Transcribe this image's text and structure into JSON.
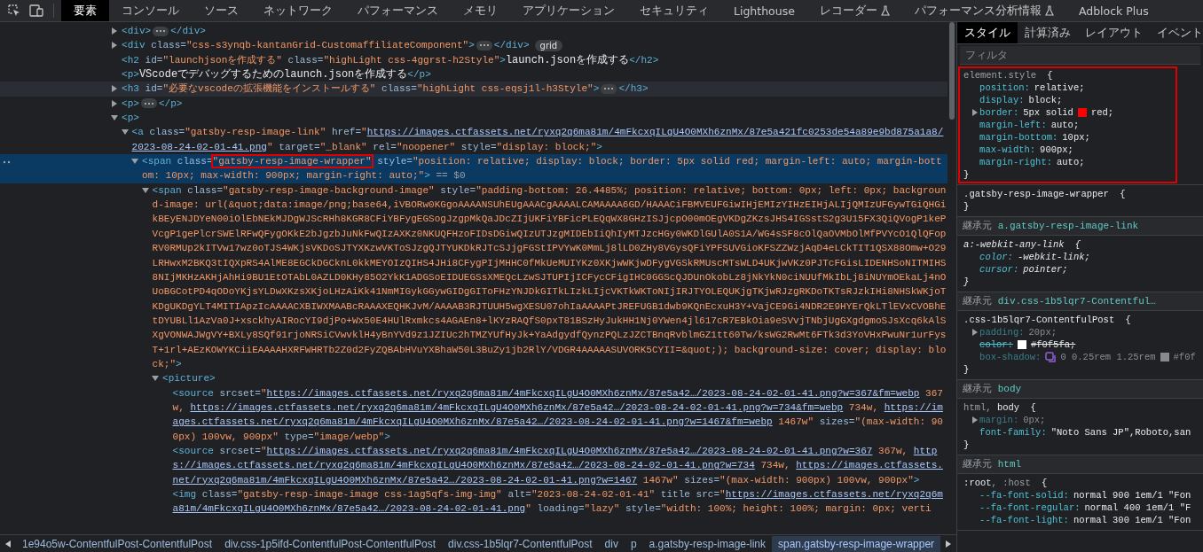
{
  "tabs": [
    {
      "label": "要素",
      "selected": true,
      "experimental": false
    },
    {
      "label": "コンソール",
      "selected": false,
      "experimental": false
    },
    {
      "label": "ソース",
      "selected": false,
      "experimental": false
    },
    {
      "label": "ネットワーク",
      "selected": false,
      "experimental": false
    },
    {
      "label": "パフォーマンス",
      "selected": false,
      "experimental": false
    },
    {
      "label": "メモリ",
      "selected": false,
      "experimental": false
    },
    {
      "label": "アプリケーション",
      "selected": false,
      "experimental": false
    },
    {
      "label": "セキュリティ",
      "selected": false,
      "experimental": false
    },
    {
      "label": "Lighthouse",
      "selected": false,
      "experimental": false
    },
    {
      "label": "レコーダー",
      "selected": false,
      "experimental": true
    },
    {
      "label": "パフォーマンス分析情報",
      "selected": false,
      "experimental": true
    },
    {
      "label": "Adblock Plus",
      "selected": false,
      "experimental": false
    }
  ],
  "elements": [
    {
      "selected": false,
      "hovered": false,
      "expanded": false,
      "parts": [
        {
          "kind": "tag",
          "text": "<div>"
        },
        {
          "kind": "ellipsis"
        },
        {
          "kind": "tag",
          "text": "</div>"
        }
      ]
    },
    {
      "selected": false,
      "hovered": false,
      "expanded": false,
      "parts": [
        {
          "kind": "tag",
          "text": "<div"
        },
        {
          "kind": "attr",
          "text": " class="
        },
        {
          "kind": "value",
          "text": "\"css-s3ynqb-kantanGrid-CustomaffiliateComponent\""
        },
        {
          "kind": "tag",
          "text": ">"
        },
        {
          "kind": "ellipsis"
        },
        {
          "kind": "tag",
          "text": "</div>"
        },
        {
          "kind": "badge",
          "text": "grid"
        }
      ]
    },
    {
      "selected": false,
      "hovered": false,
      "parts": [
        {
          "kind": "tag",
          "text": "<h2"
        },
        {
          "kind": "attr",
          "text": " id="
        },
        {
          "kind": "value",
          "text": "\"launchjsonを作成する\""
        },
        {
          "kind": "attr",
          "text": " class="
        },
        {
          "kind": "value",
          "text": "\"highLight css-4ggrst-h2Style\""
        },
        {
          "kind": "tag",
          "text": ">"
        },
        {
          "kind": "text",
          "text": "launch.jsonを作成する"
        },
        {
          "kind": "tag",
          "text": "</h2>"
        }
      ]
    },
    {
      "selected": false,
      "hovered": false,
      "parts": [
        {
          "kind": "tag",
          "text": "<p>"
        },
        {
          "kind": "text",
          "text": "VScodeでデバッグするためのlaunch.jsonを作成する"
        },
        {
          "kind": "tag",
          "text": "</p>"
        }
      ]
    },
    {
      "selected": false,
      "hovered": true,
      "expanded": false,
      "parts": [
        {
          "kind": "tag",
          "text": "<h3"
        },
        {
          "kind": "attr",
          "text": " id="
        },
        {
          "kind": "value",
          "text": "\"必要なvscodeの拡張機能をインストールする\""
        },
        {
          "kind": "attr",
          "text": " class="
        },
        {
          "kind": "value",
          "text": "\"highLight css-eqsj1l-h3Style\""
        },
        {
          "kind": "tag",
          "text": ">"
        },
        {
          "kind": "ellipsis"
        },
        {
          "kind": "tag",
          "text": "</h3>"
        }
      ]
    },
    {
      "selected": false,
      "hovered": false,
      "expanded": false,
      "parts": [
        {
          "kind": "tag",
          "text": "<p>"
        },
        {
          "kind": "ellipsis"
        },
        {
          "kind": "tag",
          "text": "</p>"
        }
      ]
    },
    {
      "selected": false,
      "hovered": false,
      "expanded": true,
      "parts": [
        {
          "kind": "tag",
          "text": "<p>"
        }
      ],
      "children": [
        {
          "selected": false,
          "hovered": false,
          "expanded": true,
          "parts": [
            {
              "kind": "tag",
              "text": "<a"
            },
            {
              "kind": "attr",
              "text": " class="
            },
            {
              "kind": "value",
              "text": "\"gatsby-resp-image-link\""
            },
            {
              "kind": "attr",
              "text": " href="
            },
            {
              "kind": "value",
              "text": "\""
            },
            {
              "kind": "link",
              "text": "https://images.ctfassets.net/ryxq2q6ma81m/4mFkcxqILgU4O0MXh6znMx/87e5a421fc0253de54a89e9bd875a1a8/2023-08-24-02-01-41.png"
            },
            {
              "kind": "value",
              "text": "\""
            },
            {
              "kind": "attr",
              "text": " target="
            },
            {
              "kind": "value",
              "text": "\"_blank\""
            },
            {
              "kind": "attr",
              "text": " rel="
            },
            {
              "kind": "value",
              "text": "\"noopener\""
            },
            {
              "kind": "attr",
              "text": " style="
            },
            {
              "kind": "value",
              "text": "\"display: block;\""
            },
            {
              "kind": "tag",
              "text": ">"
            }
          ],
          "children": [
            {
              "selected": true,
              "hovered": false,
              "expanded": true,
              "parts": [
                {
                  "kind": "tag",
                  "text": "<span"
                },
                {
                  "kind": "attr",
                  "text": " class="
                },
                {
                  "kind": "boxed",
                  "text": "\"gatsby-resp-image-wrapper\""
                },
                {
                  "kind": "attr",
                  "text": " style="
                },
                {
                  "kind": "value",
                  "text": "\"position: relative; display: block; border: 5px solid red; margin-left: auto; margin-bottom: 10px; max-width: 900px; margin-right: auto;\""
                },
                {
                  "kind": "tag",
                  "text": ">"
                },
                {
                  "kind": "marker",
                  "text": " == $0"
                }
              ],
              "children": [
                {
                  "selected": false,
                  "hovered": false,
                  "expanded": true,
                  "parts": [
                    {
                      "kind": "tag",
                      "text": "<span"
                    },
                    {
                      "kind": "attr",
                      "text": " class="
                    },
                    {
                      "kind": "value",
                      "text": "\"gatsby-resp-image-background-image\""
                    },
                    {
                      "kind": "attr",
                      "text": " style="
                    },
                    {
                      "kind": "value",
                      "text": "\"padding-bottom: 26.4485%; position: relative; bottom: 0px; left: 0px; background-image: url(&quot;data:image/png;base64,iVBORw0KGgoAAAANSUhEUgAAACgAAAALCAMAAAA6GD/HAAACiFBMVEUFGiwIHjEMIzYIHzEIHjALIjQMIzUFGywTGiQHGikBEyENJDYeN00iOlEbNEkMJDgWJScRHh8KGR8CFiYBFygEGSogJzgpMkQaJDcZIjUKFiYBFicPLEQqWX8GHzISJjcpO00mOEgVKDgZKzsJHS4IGSstS2g3U15FX3QiQVogP1kePVcgP1gePlcrSWElRFwQFygOKkE2bJgzbJuNkFwQIzAXKz0NKUQFHzoFIDsDGiwQIzUTJzgMIDEbIiQhIyMTJzcHGy0WKDlGUlA0S1A/WG4sSF8cOlQaOVMbOlMfPVYcO1QlQFopRV0RMUp2kITVw17wz0oTJS4WKjsVKDoSJTYXKzwVKToSJzgQJTYUKDkRJTcSJjgFGStIPVYwK0MmLj8lLD0ZHy8VGysQFiYPFSUVGioKFSZZWzjAqD4eLCkTIT1QSX88Omw+O29LRHwxM2BKQ3tIQXpRS4AlME8EGCkDGCknL0kkMEYOIzQIHS4JHi8CFygPIjMHHC0fMkUeMUIYKz0XKjwWKjwDFygVGSkRMUscMTsWLD4UKjwVKz0PJTcFGisLIDENHSoNITMIHS8NIjMKHzAKHjAhHi9BU1EtOTAbL0AZLD0KHy85O2YkK1ADGSoEIDUEGSsXMEQcLzwSJTUPIjICFycCFigIHC0GGScQJDUnOkobLz8jNkYkN0ciNUUfMkIbLj8iNUYmOEkaLj4nOUoBGCotPD4qODoYKjsYLDwXKzsXKjoLHzAiKk41NmMIGykGGywGIDgGIToFHzYNJDkGITkLIzkLIjcVKTkWKToNIjIRJTYOLEQUKjgTKjwRJzgRKDoTKTsRJzkIHi8NHSkWKjoTKDgUKDgYLT4MITIApzIcAAAACXBIWXMAABcRAAAXEQHKJvM/AAAAB3RJTUUH5wgXESU07ohIaAAAAPtJREFUGB1dwb9KQnEcxuH3Y+VajCE9Gi4NDR2E9HYErQkLTlEVxCVOBhEtDYUBLl1AzVa0J+xsckhyAIRocYI9djPo+Wx50E4HUlRxmkcs4AGAEn8+lKYzRAQfS0pxT81BSzHyJukHH1Nj0YWen4jl617cR7EBkOia9eSVvjTNbjUgGXgdgmoSJsXcq6kAlSXgVONWAJWgVY+BXLy8SQf91rjoNRSiCVwvklH4yBnYVd9z1JZIUc2hTMZYUfHyJk+YaAdgydfQynzPQLzJZCTBnqRvblmGZ1tt60Tw/ksWG2RwMt6FTk3d3YoVHxPwuNr1urFysT+1rl+AEzKOWYKCiiEAAAAHXRFWHRTb2Z0d2FyZQBAbHVuYXBhaW50L3BuZy1jb2RlY/VDGR4AAAAASUVORK5CYII=&quot;); background-size: cover; display: block;\""
                    },
                    {
                      "kind": "tag",
                      "text": ">"
                    }
                  ],
                  "children": [
                    {
                      "selected": false,
                      "hovered": false,
                      "expanded": true,
                      "parts": [
                        {
                          "kind": "tag",
                          "text": "<picture>"
                        }
                      ],
                      "children": [
                        {
                          "selected": false,
                          "hovered": false,
                          "parts": [
                            {
                              "kind": "tag",
                              "text": "<source"
                            },
                            {
                              "kind": "attr",
                              "text": " srcset="
                            },
                            {
                              "kind": "value",
                              "text": "\""
                            },
                            {
                              "kind": "link",
                              "text": "https://images.ctfassets.net/ryxq2q6ma81m/4mFkcxqILgU4O0MXh6znMx/87e5a42…/2023-08-24-02-01-41.png?w=367&fm=webp"
                            },
                            {
                              "kind": "value",
                              "text": " 367w, "
                            },
                            {
                              "kind": "link",
                              "text": "https://images.ctfassets.net/ryxq2q6ma81m/4mFkcxqILgU4O0MXh6znMx/87e5a42…/2023-08-24-02-01-41.png?w=734&fm=webp"
                            },
                            {
                              "kind": "value",
                              "text": " 734w, "
                            },
                            {
                              "kind": "link",
                              "text": "https://images.ctfassets.net/ryxq2q6ma81m/4mFkcxqILgU4O0MXh6znMx/87e5a42…/2023-08-24-02-01-41.png?w=1467&fm=webp"
                            },
                            {
                              "kind": "value",
                              "text": " 1467w\""
                            },
                            {
                              "kind": "attr",
                              "text": " sizes="
                            },
                            {
                              "kind": "value",
                              "text": "\"(max-width: 900px) 100vw, 900px\""
                            },
                            {
                              "kind": "attr",
                              "text": " type="
                            },
                            {
                              "kind": "value",
                              "text": "\"image/webp\""
                            },
                            {
                              "kind": "tag",
                              "text": ">"
                            }
                          ]
                        },
                        {
                          "selected": false,
                          "hovered": false,
                          "parts": [
                            {
                              "kind": "tag",
                              "text": "<source"
                            },
                            {
                              "kind": "attr",
                              "text": " srcset="
                            },
                            {
                              "kind": "value",
                              "text": "\""
                            },
                            {
                              "kind": "link",
                              "text": "https://images.ctfassets.net/ryxq2q6ma81m/4mFkcxqILgU4O0MXh6znMx/87e5a42…/2023-08-24-02-01-41.png?w=367"
                            },
                            {
                              "kind": "value",
                              "text": " 367w, "
                            },
                            {
                              "kind": "link",
                              "text": "https://images.ctfassets.net/ryxq2q6ma81m/4mFkcxqILgU4O0MXh6znMx/87e5a42…/2023-08-24-02-01-41.png?w=734"
                            },
                            {
                              "kind": "value",
                              "text": " 734w, "
                            },
                            {
                              "kind": "link",
                              "text": "https://images.ctfassets.net/ryxq2q6ma81m/4mFkcxqILgU4O0MXh6znMx/87e5a42…/2023-08-24-02-01-41.png?w=1467"
                            },
                            {
                              "kind": "value",
                              "text": " 1467w\""
                            },
                            {
                              "kind": "attr",
                              "text": " sizes="
                            },
                            {
                              "kind": "value",
                              "text": "\"(max-width: 900px) 100vw, 900px\""
                            },
                            {
                              "kind": "tag",
                              "text": ">"
                            }
                          ]
                        },
                        {
                          "selected": false,
                          "hovered": false,
                          "parts": [
                            {
                              "kind": "tag",
                              "text": "<img"
                            },
                            {
                              "kind": "attr",
                              "text": " class="
                            },
                            {
                              "kind": "value",
                              "text": "\"gatsby-resp-image-image css-1ag5qfs-img-img\""
                            },
                            {
                              "kind": "attr",
                              "text": " alt="
                            },
                            {
                              "kind": "value",
                              "text": "\"2023-08-24-02-01-41\""
                            },
                            {
                              "kind": "attr",
                              "text": " title src="
                            },
                            {
                              "kind": "value",
                              "text": "\""
                            },
                            {
                              "kind": "link",
                              "text": "https://images.ctfassets.net/ryxq2q6ma81m/4mFkcxqILgU4O0MXh6znMx/87e5a42…/2023-08-24-02-01-41.png"
                            },
                            {
                              "kind": "value",
                              "text": "\""
                            },
                            {
                              "kind": "attr",
                              "text": " loading="
                            },
                            {
                              "kind": "value",
                              "text": "\"lazy\""
                            },
                            {
                              "kind": "attr",
                              "text": " style="
                            },
                            {
                              "kind": "value",
                              "text": "\"width: 100%; height: 100%; margin: 0px; verti"
                            }
                          ]
                        }
                      ]
                    }
                  ]
                }
              ]
            }
          ]
        }
      ]
    }
  ],
  "breadcrumbs": [
    {
      "label": "1e94o5w-ContentfulPost-ContentfulPost",
      "selected": false
    },
    {
      "label": "div.css-1p5ifd-ContentfulPost-ContentfulPost",
      "selected": false
    },
    {
      "label": "div.css-1b5lqr7-ContentfulPost",
      "selected": false
    },
    {
      "label": "div",
      "selected": false
    },
    {
      "label": "p",
      "selected": false
    },
    {
      "label": "a.gatsby-resp-image-link",
      "selected": false
    },
    {
      "label": "span.gatsby-resp-image-wrapper",
      "selected": true
    }
  ],
  "style_tabs": [
    {
      "label": "スタイル",
      "selected": true
    },
    {
      "label": "計算済み",
      "selected": false
    },
    {
      "label": "レイアウト",
      "selected": false
    },
    {
      "label": "イベント",
      "selected": false
    }
  ],
  "filter": {
    "placeholder": "フィルタ"
  },
  "styles": [
    {
      "kind": "rule",
      "highlighted": true,
      "user_agent": false,
      "selector": [
        {
          "text": "element.style",
          "matched": false
        }
      ],
      "open": "{",
      "close": "}",
      "properties": [
        {
          "name": "position:",
          "expandable": false,
          "inactive": false,
          "struck": false,
          "value": [
            {
              "kind": "text",
              "text": "relative;"
            }
          ]
        },
        {
          "name": "display:",
          "expandable": false,
          "inactive": false,
          "struck": false,
          "value": [
            {
              "kind": "text",
              "text": "block;"
            }
          ]
        },
        {
          "name": "border:",
          "expandable": true,
          "inactive": false,
          "struck": false,
          "value": [
            {
              "kind": "text",
              "text": "5px solid"
            },
            {
              "kind": "swatch",
              "color": "#ff0000"
            },
            {
              "kind": "text",
              "text": "red;"
            }
          ]
        },
        {
          "name": "margin-left:",
          "expandable": false,
          "inactive": false,
          "struck": false,
          "value": [
            {
              "kind": "text",
              "text": "auto;"
            }
          ]
        },
        {
          "name": "margin-bottom:",
          "expandable": false,
          "inactive": false,
          "struck": false,
          "value": [
            {
              "kind": "text",
              "text": "10px;"
            }
          ]
        },
        {
          "name": "max-width:",
          "expandable": false,
          "inactive": false,
          "struck": false,
          "value": [
            {
              "kind": "text",
              "text": "900px;"
            }
          ]
        },
        {
          "name": "margin-right:",
          "expandable": false,
          "inactive": false,
          "struck": false,
          "value": [
            {
              "kind": "text",
              "text": "auto;"
            }
          ]
        }
      ]
    },
    {
      "kind": "rule",
      "highlighted": false,
      "user_agent": false,
      "selector": [
        {
          "text": ".gatsby-resp-image-wrapper",
          "matched": true
        }
      ],
      "open": "{",
      "close": "}"
    },
    {
      "kind": "inherited",
      "label": "継承元",
      "source": "a.gatsby-resp-image-link"
    },
    {
      "kind": "rule",
      "highlighted": false,
      "user_agent": true,
      "selector": [
        {
          "text": "a:-webkit-any-link",
          "matched": true
        }
      ],
      "open": "{",
      "close": "}",
      "properties": [
        {
          "name": "color:",
          "expandable": false,
          "inactive": false,
          "struck": false,
          "value": [
            {
              "kind": "text",
              "text": "-webkit-link;"
            }
          ]
        },
        {
          "name": "cursor:",
          "expandable": false,
          "inactive": false,
          "struck": false,
          "value": [
            {
              "kind": "text",
              "text": "pointer;"
            }
          ]
        }
      ]
    },
    {
      "kind": "inherited",
      "label": "継承元",
      "source": "div.css-1b5lqr7-Contentful…"
    },
    {
      "kind": "rule",
      "highlighted": false,
      "user_agent": false,
      "selector": [
        {
          "text": ".css-1b5lqr7-ContentfulPost",
          "matched": true
        }
      ],
      "open": "{",
      "close": "}",
      "properties": [
        {
          "name": "padding:",
          "expandable": true,
          "inactive": true,
          "struck": false,
          "value": [
            {
              "kind": "text",
              "text": "20px;"
            }
          ]
        },
        {
          "name": "color:",
          "expandable": false,
          "inactive": false,
          "struck": true,
          "value": [
            {
              "kind": "swatch",
              "color": "#ffffff"
            },
            {
              "kind": "text",
              "text": "#f0f5fa;"
            }
          ]
        },
        {
          "name": "box-shadow:",
          "expandable": false,
          "inactive": true,
          "struck": false,
          "value": [
            {
              "kind": "shadow"
            },
            {
              "kind": "text",
              "text": "0 0.25rem 1.25rem"
            },
            {
              "kind": "swatch",
              "color": "#8a8a8a"
            },
            {
              "kind": "text",
              "text": "#f0f"
            }
          ]
        }
      ]
    },
    {
      "kind": "inherited",
      "label": "継承元",
      "source": "body"
    },
    {
      "kind": "rule",
      "highlighted": false,
      "user_agent": false,
      "selector": [
        {
          "text": "html, ",
          "matched": false
        },
        {
          "text": "body",
          "matched": true
        }
      ],
      "open": "{",
      "close": "}",
      "properties": [
        {
          "name": "margin:",
          "expandable": true,
          "inactive": true,
          "struck": false,
          "value": [
            {
              "kind": "text",
              "text": "0px;"
            }
          ]
        },
        {
          "name": "font-family:",
          "expandable": false,
          "inactive": false,
          "struck": false,
          "value": [
            {
              "kind": "text",
              "text": "\"Noto Sans JP\",Roboto,san"
            }
          ]
        }
      ]
    },
    {
      "kind": "inherited",
      "label": "継承元",
      "source": "html"
    },
    {
      "kind": "rule",
      "highlighted": false,
      "user_agent": false,
      "selector": [
        {
          "text": ":root",
          "matched": true
        },
        {
          "text": ", :host",
          "matched": false
        }
      ],
      "open": "{",
      "properties": [
        {
          "name": "--fa-font-solid:",
          "expandable": false,
          "inactive": false,
          "struck": false,
          "value": [
            {
              "kind": "text",
              "text": "normal 900 1em/1 \"Fon"
            }
          ]
        },
        {
          "name": "--fa-font-regular:",
          "expandable": false,
          "inactive": false,
          "struck": false,
          "value": [
            {
              "kind": "text",
              "text": "normal 400 1em/1 \"F"
            }
          ]
        },
        {
          "name": "--fa-font-light:",
          "expandable": false,
          "inactive": false,
          "struck": false,
          "value": [
            {
              "kind": "text",
              "text": "normal 300 1em/1 \"Fon"
            }
          ]
        }
      ]
    }
  ]
}
